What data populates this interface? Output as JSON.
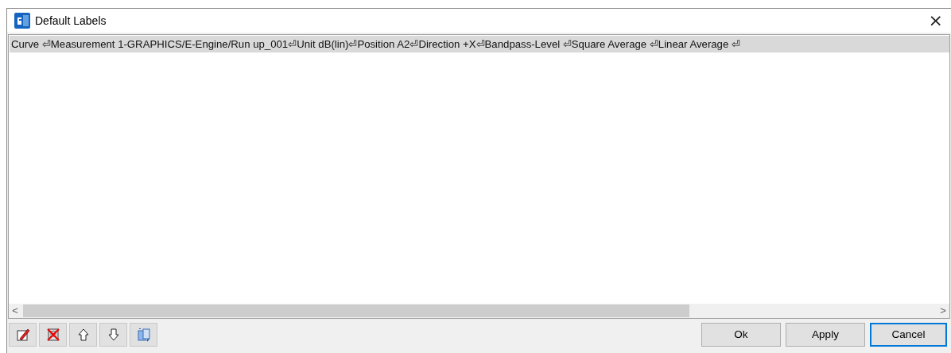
{
  "window": {
    "title": "Default Labels",
    "close": "×"
  },
  "list": {
    "rows": [
      {
        "text": "Curve ⏎Measurement 1-GRAPHICS/E-Engine/Run up_001⏎Unit dB(lin)⏎Position A2⏎Direction +X⏎Bandpass-Level ⏎Square Average ⏎Linear Average ⏎",
        "selected": true
      }
    ]
  },
  "scrollbar": {
    "left": "<",
    "right": ">"
  },
  "toolbar": [
    {
      "kind": "edit"
    },
    {
      "kind": "delete"
    },
    {
      "kind": "up"
    },
    {
      "kind": "down"
    },
    {
      "kind": "swap"
    }
  ],
  "buttons": [
    {
      "label": "Ok",
      "default": false
    },
    {
      "label": "Apply",
      "default": false
    },
    {
      "label": "Cancel",
      "default": true
    }
  ]
}
